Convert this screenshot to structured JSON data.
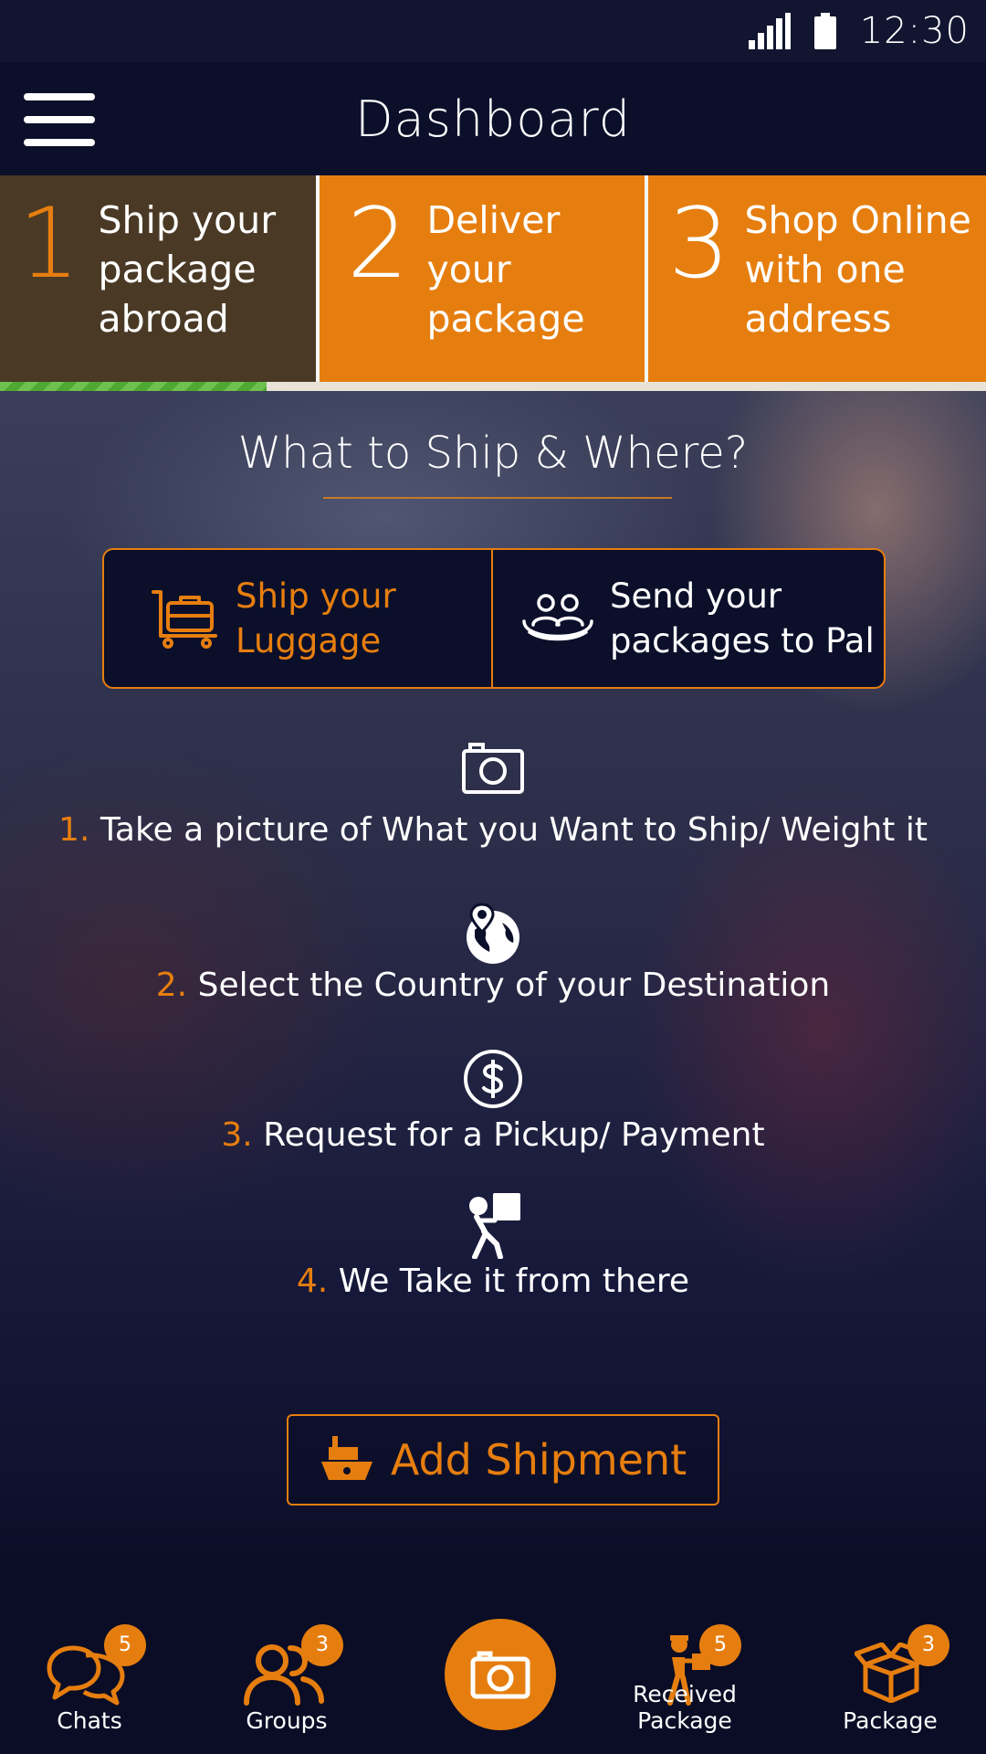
{
  "status_bar": {
    "time": "12:30"
  },
  "header": {
    "title": "Dashboard"
  },
  "steps": [
    {
      "number": "1",
      "label": "Ship your package abroad",
      "active": true
    },
    {
      "number": "2",
      "label": "Deliver your package",
      "active": false
    },
    {
      "number": "3",
      "label": "Shop Online with one address",
      "active": false
    }
  ],
  "progress": {
    "fraction": 0.27
  },
  "hero": {
    "title": "What to Ship & Where?",
    "options": [
      {
        "label": "Ship your Luggage",
        "icon": "luggage-cart-icon"
      },
      {
        "label": "Send your packages to Pal",
        "icon": "people-icon"
      }
    ],
    "instructions": [
      {
        "num": "1.",
        "text": "Take a picture of What you Want to Ship/ Weight it",
        "icon": "camera-icon"
      },
      {
        "num": "2.",
        "text": "Select the Country of your Destination",
        "icon": "globe-pin-icon"
      },
      {
        "num": "3.",
        "text": "Request for a Pickup/ Payment",
        "icon": "dollar-icon"
      },
      {
        "num": "4.",
        "text": "We Take it from there",
        "icon": "delivery-person-icon"
      }
    ],
    "add_button": "Add Shipment"
  },
  "bottom_nav": {
    "chats": {
      "label": "Chats",
      "badge": "5"
    },
    "groups": {
      "label": "Groups",
      "badge": "3"
    },
    "received": {
      "label": "Received Package",
      "badge": "5"
    },
    "package": {
      "label": "Package",
      "badge": "3"
    }
  },
  "colors": {
    "accent": "#e67e0f",
    "header_bg": "#0b0f2a",
    "active_step_bg": "#4a3a25",
    "progress": "#6fc14f"
  }
}
